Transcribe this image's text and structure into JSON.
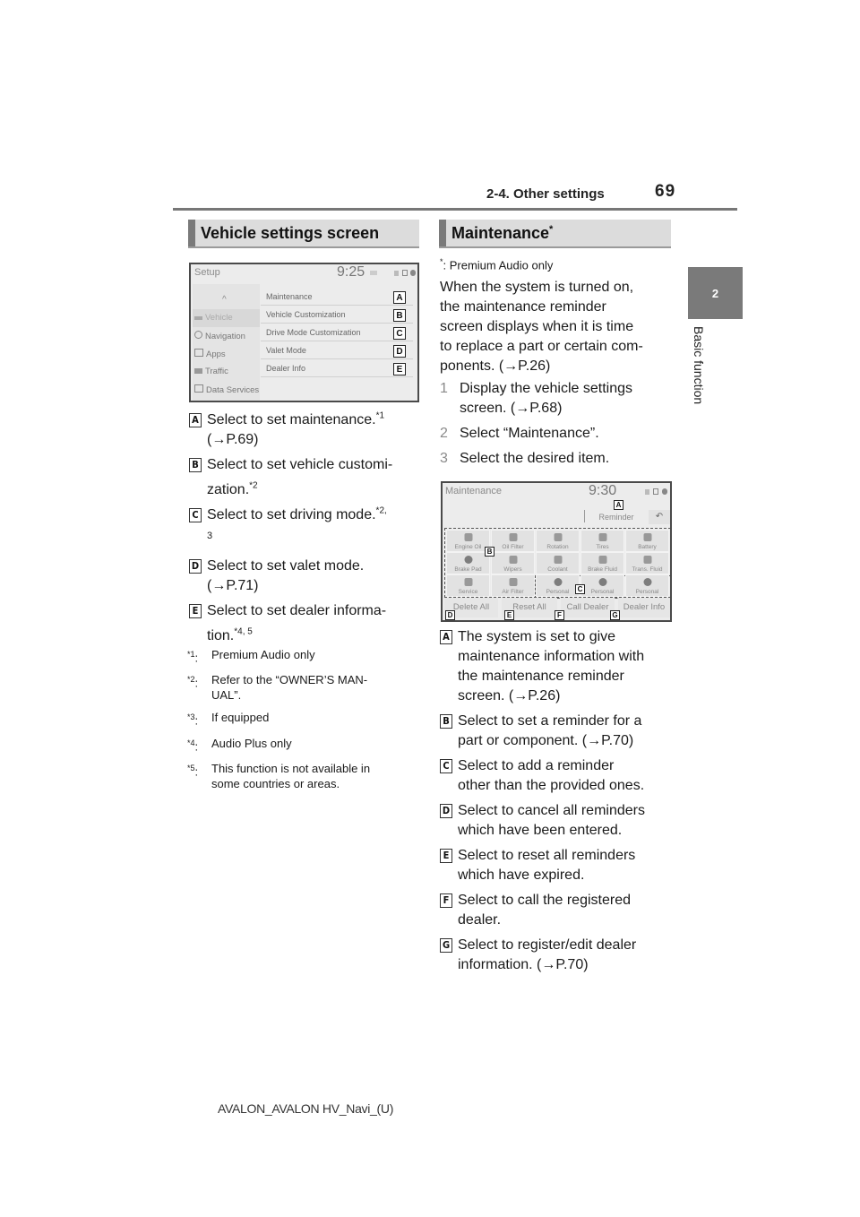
{
  "header": {
    "section_title": "2-4. Other settings",
    "page_number": "69"
  },
  "side_tab": {
    "chapter_number": "2",
    "chapter_label": "Basic function"
  },
  "left": {
    "section_title": "Vehicle settings screen",
    "screen": {
      "title": "Setup",
      "time": "9:25",
      "side_items": [
        "Vehicle",
        "Navigation",
        "Apps",
        "Traffic",
        "Data Services"
      ],
      "menu_items": [
        {
          "label": "Maintenance",
          "callout": "A"
        },
        {
          "label": "Vehicle Customization",
          "callout": "B"
        },
        {
          "label": "Drive Mode Customization",
          "callout": "C"
        },
        {
          "label": "Valet Mode",
          "callout": "D"
        },
        {
          "label": "Dealer Info",
          "callout": "E"
        }
      ]
    },
    "items": [
      {
        "badge": "A",
        "text": "Select to set maintenance.",
        "sup": "*1",
        "text2": "(→P.69)"
      },
      {
        "badge": "B",
        "text": "Select to set vehicle customi-",
        "text2": "zation.",
        "sup": "*2"
      },
      {
        "badge": "C",
        "text": "Select to set driving mode.",
        "sup": "*2,",
        "text2": "3"
      },
      {
        "badge": "D",
        "text": "Select to set valet mode.",
        "text2": "(→P.71)"
      },
      {
        "badge": "E",
        "text": "Select to set dealer informa-",
        "text2": "tion.",
        "sup": "*4, 5"
      }
    ],
    "footnotes": [
      {
        "mark": "*1",
        "text": "Premium Audio only"
      },
      {
        "mark": "*2",
        "text": "Refer to the “OWNER’S MAN-",
        "text2": "UAL”."
      },
      {
        "mark": "*3",
        "text": "If equipped"
      },
      {
        "mark": "*4",
        "text": "Audio Plus only"
      },
      {
        "mark": "*5",
        "text": "This function is not available in",
        "text2": "some countries or areas."
      }
    ]
  },
  "right": {
    "section_title": "Maintenance",
    "section_title_sup": "*",
    "note_mark": "*",
    "note_text": ": Premium Audio only",
    "intro": [
      "When the system is turned on,",
      "the maintenance reminder",
      "screen displays when it is time",
      "to replace a part or certain com-",
      "ponents. (→P.26)"
    ],
    "steps": [
      {
        "num": "1",
        "text": "Display the vehicle settings",
        "text2": "screen. (→P.68)"
      },
      {
        "num": "2",
        "text": "Select “Maintenance”."
      },
      {
        "num": "3",
        "text": "Select the desired item."
      }
    ],
    "screen": {
      "title": "Maintenance",
      "time": "9:30",
      "reminder_label": "Reminder",
      "tiles": [
        "Engine Oil",
        "Oil Filter",
        "Rotation",
        "Tires",
        "Battery",
        "Brake Pad",
        "Wipers",
        "Coolant",
        "Brake Fluid",
        "Trans. Fluid",
        "Service",
        "Air Filter",
        "Personal",
        "Personal",
        "Personal"
      ],
      "bottom_buttons": [
        "Delete All",
        "Reset All",
        "Call Dealer",
        "Dealer Info"
      ],
      "callouts": [
        "A",
        "B",
        "C",
        "D",
        "E",
        "F",
        "G"
      ]
    },
    "items": [
      {
        "badge": "A",
        "lines": [
          "The system is set to give",
          "maintenance information with",
          "the maintenance reminder",
          "screen. (→P.26)"
        ]
      },
      {
        "badge": "B",
        "lines": [
          "Select to set a reminder for a",
          "part or component. (→P.70)"
        ]
      },
      {
        "badge": "C",
        "lines": [
          "Select to add a reminder",
          "other than the provided ones."
        ]
      },
      {
        "badge": "D",
        "lines": [
          "Select to cancel all reminders",
          "which have been entered."
        ]
      },
      {
        "badge": "E",
        "lines": [
          "Select to reset all reminders",
          "which have expired."
        ]
      },
      {
        "badge": "F",
        "lines": [
          "Select to call the registered",
          "dealer."
        ]
      },
      {
        "badge": "G",
        "lines": [
          "Select to register/edit dealer",
          "information. (→P.70)"
        ]
      }
    ]
  },
  "footer": {
    "doc_id": "AVALON_AVALON HV_Navi_(U)"
  }
}
